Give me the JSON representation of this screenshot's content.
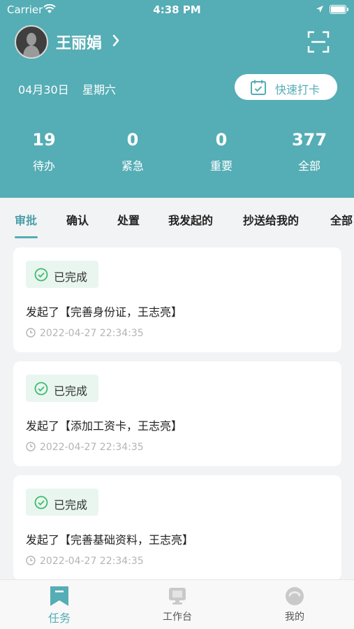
{
  "status_bar": {
    "carrier": "Carrier",
    "time": "4:38 PM"
  },
  "header": {
    "username": "王丽娟",
    "date": "04月30日",
    "weekday": "星期六",
    "checkin_label": "快速打卡",
    "accent_color": "#55adb5"
  },
  "stats": [
    {
      "value": "19",
      "label": "待办"
    },
    {
      "value": "0",
      "label": "紧急"
    },
    {
      "value": "0",
      "label": "重要"
    },
    {
      "value": "377",
      "label": "全部"
    }
  ],
  "tabs": [
    {
      "label": "审批",
      "active": true
    },
    {
      "label": "确认"
    },
    {
      "label": "处置"
    },
    {
      "label": "我发起的"
    },
    {
      "label": "抄送给我的"
    },
    {
      "label": "全部"
    }
  ],
  "cards": [
    {
      "status": "已完成",
      "title": "发起了【完善身份证，王志亮】",
      "time": "2022-04-27 22:34:35"
    },
    {
      "status": "已完成",
      "title": "发起了【添加工资卡，王志亮】",
      "time": "2022-04-27 22:34:35"
    },
    {
      "status": "已完成",
      "title": "发起了【完善基础资料，王志亮】",
      "time": "2022-04-27 22:34:35"
    }
  ],
  "tabbar": [
    {
      "label": "任务",
      "icon": "bookmark-icon",
      "active": true
    },
    {
      "label": "工作台",
      "icon": "monitor-icon"
    },
    {
      "label": "我的",
      "icon": "profile-icon"
    }
  ]
}
